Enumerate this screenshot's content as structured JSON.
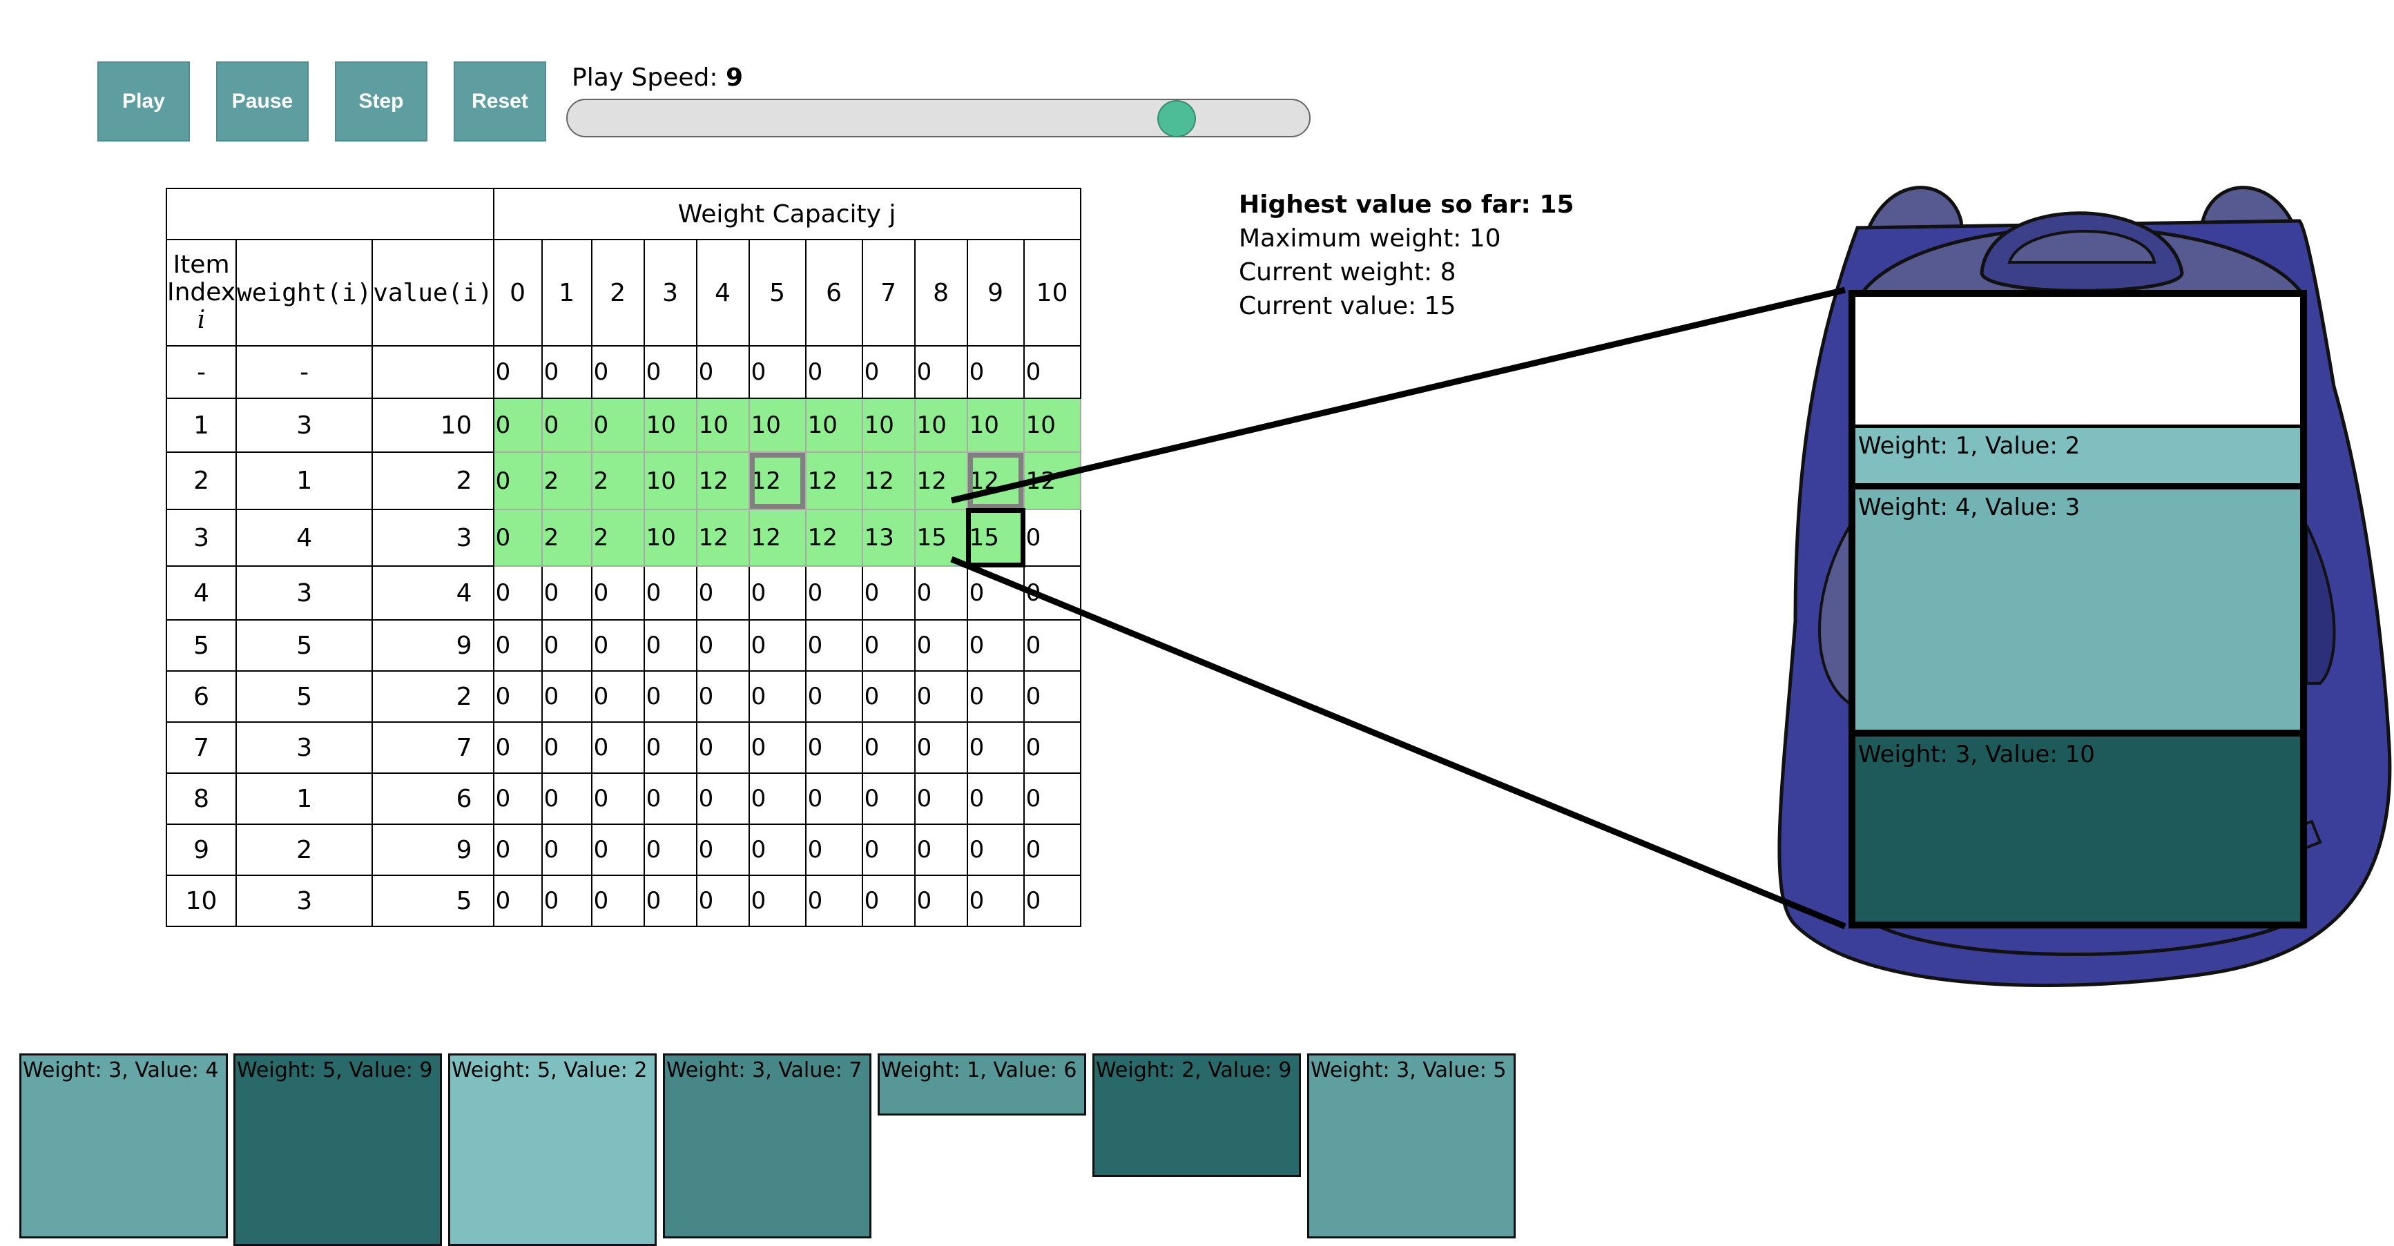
{
  "controls": {
    "play_label": "Play",
    "pause_label": "Pause",
    "step_label": "Step",
    "reset_label": "Reset",
    "speed_prefix": "Play Speed: ",
    "speed_value": "9",
    "speed_level": 0.82
  },
  "table": {
    "capacity_header": "Weight Capacity j",
    "item_index_header": [
      "Item",
      "Index",
      "i"
    ],
    "weight_header": "weight(i)",
    "value_header": "value(i)",
    "capacities": [
      "0",
      "1",
      "2",
      "3",
      "4",
      "5",
      "6",
      "7",
      "8",
      "9",
      "10"
    ],
    "rows": [
      {
        "index": "-",
        "weight": "-",
        "value": "",
        "cells": [
          "0",
          "0",
          "0",
          "0",
          "0",
          "0",
          "0",
          "0",
          "0",
          "0",
          "0"
        ]
      },
      {
        "index": "1",
        "weight": "3",
        "value": "10",
        "cells": [
          "0",
          "0",
          "0",
          "10",
          "10",
          "10",
          "10",
          "10",
          "10",
          "10",
          "10"
        ]
      },
      {
        "index": "2",
        "weight": "1",
        "value": "2",
        "cells": [
          "0",
          "2",
          "2",
          "10",
          "12",
          "12",
          "12",
          "12",
          "12",
          "12",
          "12"
        ]
      },
      {
        "index": "3",
        "weight": "4",
        "value": "3",
        "cells": [
          "0",
          "2",
          "2",
          "10",
          "12",
          "12",
          "12",
          "13",
          "15",
          "15",
          "0"
        ]
      },
      {
        "index": "4",
        "weight": "3",
        "value": "4",
        "cells": [
          "0",
          "0",
          "0",
          "0",
          "0",
          "0",
          "0",
          "0",
          "0",
          "0",
          "0"
        ]
      },
      {
        "index": "5",
        "weight": "5",
        "value": "9",
        "cells": [
          "0",
          "0",
          "0",
          "0",
          "0",
          "0",
          "0",
          "0",
          "0",
          "0",
          "0"
        ]
      },
      {
        "index": "6",
        "weight": "5",
        "value": "2",
        "cells": [
          "0",
          "0",
          "0",
          "0",
          "0",
          "0",
          "0",
          "0",
          "0",
          "0",
          "0"
        ]
      },
      {
        "index": "7",
        "weight": "3",
        "value": "7",
        "cells": [
          "0",
          "0",
          "0",
          "0",
          "0",
          "0",
          "0",
          "0",
          "0",
          "0",
          "0"
        ]
      },
      {
        "index": "8",
        "weight": "1",
        "value": "6",
        "cells": [
          "0",
          "0",
          "0",
          "0",
          "0",
          "0",
          "0",
          "0",
          "0",
          "0",
          "0"
        ]
      },
      {
        "index": "9",
        "weight": "2",
        "value": "9",
        "cells": [
          "0",
          "0",
          "0",
          "0",
          "0",
          "0",
          "0",
          "0",
          "0",
          "0",
          "0"
        ]
      },
      {
        "index": "10",
        "weight": "3",
        "value": "5",
        "cells": [
          "0",
          "0",
          "0",
          "0",
          "0",
          "0",
          "0",
          "0",
          "0",
          "0",
          "0"
        ]
      }
    ]
  },
  "stats": {
    "highest": "Highest value so far: 15",
    "max_weight": "Maximum weight: 10",
    "current_weight": "Current weight: 8",
    "current_value": "Current value: 15"
  },
  "knapsack_items": [
    {
      "label": "Weight: 1, Value: 2",
      "color": "#7fbfbf"
    },
    {
      "label": "Weight: 4, Value: 3",
      "color": "#73b3b3"
    },
    {
      "label": "Weight: 3, Value: 10",
      "color": "#1f5a5a"
    }
  ],
  "remaining_items": [
    {
      "label": "Weight: 3, Value: 4",
      "color": "#66a6a6"
    },
    {
      "label": "Weight: 5, Value: 9",
      "color": "#2a6969"
    },
    {
      "label": "Weight: 5, Value: 2",
      "color": "#7fbfbf"
    },
    {
      "label": "Weight: 3, Value: 7",
      "color": "#478787"
    },
    {
      "label": "Weight: 1, Value: 6",
      "color": "#579797"
    },
    {
      "label": "Weight: 2, Value: 9",
      "color": "#2a6969"
    },
    {
      "label": "Weight: 3, Value: 5",
      "color": "#5f9f9f"
    }
  ],
  "colors": {
    "button": "#5f9ea0",
    "filled_cell": "#90ee90",
    "backpack_dark": "#3c3f9a",
    "backpack_light": "#575a91"
  }
}
